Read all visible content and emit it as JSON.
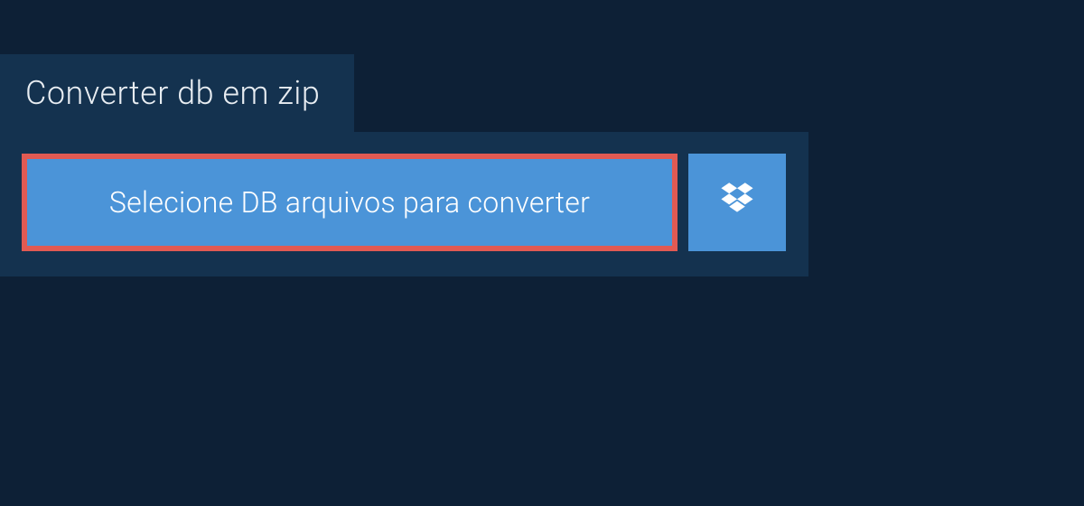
{
  "tab": {
    "title": "Converter db em zip"
  },
  "panel": {
    "select_label": "Selecione DB arquivos para converter"
  }
}
